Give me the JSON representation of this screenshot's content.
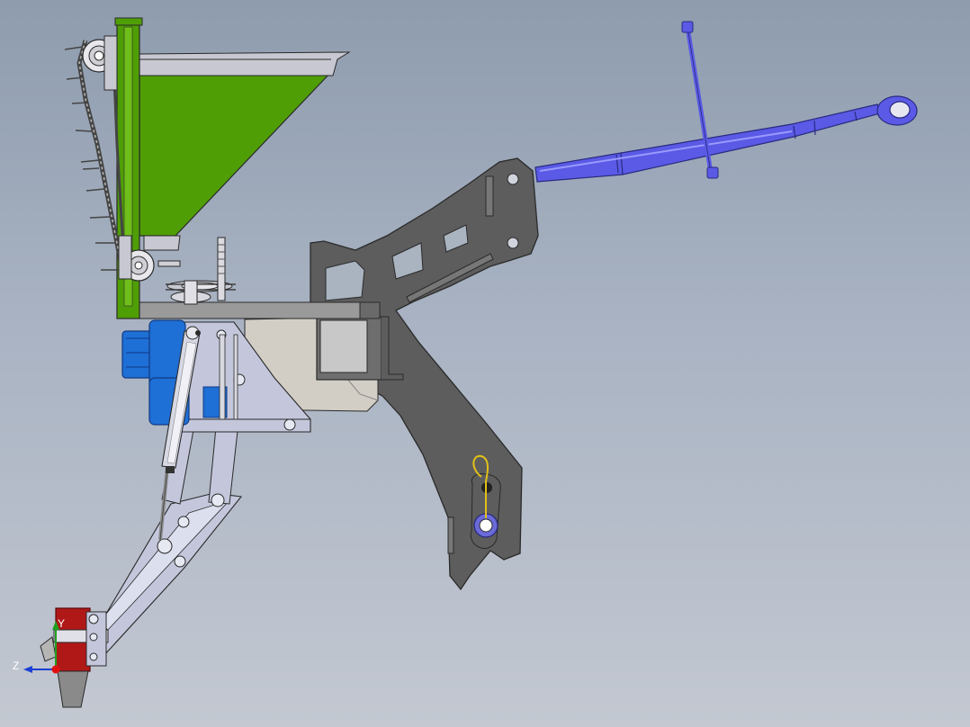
{
  "viewport": {
    "background_top": "#8e9cae",
    "background_bottom": "#c3c8d1"
  },
  "triad": {
    "y_label": "Y",
    "z_label": "Z",
    "colors": {
      "y": "#20a020",
      "z": "#1b3fd4",
      "x": "#e01010"
    }
  },
  "parts": {
    "hopper": {
      "color": "#4f9e06"
    },
    "frame": {
      "color": "#5d5d5d"
    },
    "top_link": {
      "color": "#5a5ae6"
    },
    "motor": {
      "color": "#1e6fd6"
    },
    "ground_tool": {
      "color": "#b01818"
    },
    "linkage": {
      "color": "#c4c7dc"
    },
    "guard": {
      "color": "#d2cec6"
    },
    "safety_pin": {
      "color": "#e2c01a"
    }
  }
}
